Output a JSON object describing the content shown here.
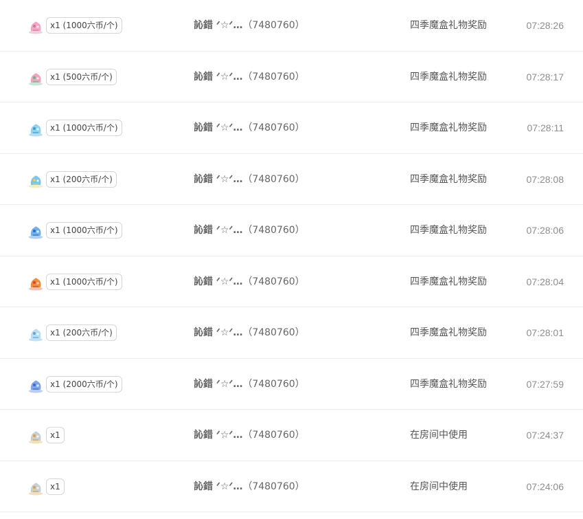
{
  "records": [
    {
      "icon": "pink-bunny-gift-icon",
      "icon_color": "#f4a7c4",
      "icon_accent": "#c77aa0",
      "qty": "x1 (1000六币/个)",
      "user_name": "訫錯 ᐟ☆ᐟ…",
      "user_id": "（7480760）",
      "reason": "四季魔盒礼物奖励",
      "time": "07:28:26"
    },
    {
      "icon": "lotus-gift-icon",
      "icon_color": "#f3a3c0",
      "icon_accent": "#66b98a",
      "qty": "x1 (500六币/个)",
      "user_name": "訫錯 ᐟ☆ᐟ…",
      "user_id": "（7480760）",
      "reason": "四季魔盒礼物奖励",
      "time": "07:28:17"
    },
    {
      "icon": "ice-swirl-gift-icon",
      "icon_color": "#8fd3ef",
      "icon_accent": "#3c9ccf",
      "qty": "x1 (1000六币/个)",
      "user_name": "訫錯 ᐟ☆ᐟ…",
      "user_id": "（7480760）",
      "reason": "四季魔盒礼物奖励",
      "time": "07:28:11"
    },
    {
      "icon": "flower-garland-gift-icon",
      "icon_color": "#7cc6e8",
      "icon_accent": "#f0c94a",
      "qty": "x1 (200六币/个)",
      "user_name": "訫錯 ᐟ☆ᐟ…",
      "user_id": "（7480760）",
      "reason": "四季魔盒礼物奖励",
      "time": "07:28:08"
    },
    {
      "icon": "ice-castle-gift-icon",
      "icon_color": "#6fb3ea",
      "icon_accent": "#2a6fc2",
      "qty": "x1 (1000六币/个)",
      "user_name": "訫錯 ᐟ☆ᐟ…",
      "user_id": "（7480760）",
      "reason": "四季魔盒礼物奖励",
      "time": "07:28:06"
    },
    {
      "icon": "fox-gift-icon",
      "icon_color": "#f28a3c",
      "icon_accent": "#d9452b",
      "qty": "x1 (1000六币/个)",
      "user_name": "訫錯 ᐟ☆ᐟ…",
      "user_id": "（7480760）",
      "reason": "四季魔盒礼物奖励",
      "time": "07:28:04"
    },
    {
      "icon": "snow-figure-gift-icon",
      "icon_color": "#b8def0",
      "icon_accent": "#5aa8d8",
      "qty": "x1 (200六币/个)",
      "user_name": "訫錯 ᐟ☆ᐟ…",
      "user_id": "（7480760）",
      "reason": "四季魔盒礼物奖励",
      "time": "07:28:01"
    },
    {
      "icon": "blue-fairy-gift-icon",
      "icon_color": "#7fa6e6",
      "icon_accent": "#3d6cc9",
      "qty": "x1 (2000六币/个)",
      "user_name": "訫錯 ᐟ☆ᐟ…",
      "user_id": "（7480760）",
      "reason": "四季魔盒礼物奖励",
      "time": "07:27:59"
    },
    {
      "icon": "crown-gift-icon",
      "icon_color": "#c9cfd6",
      "icon_accent": "#d9a441",
      "qty": "x1",
      "user_name": "訫錯 ᐟ☆ᐟ…",
      "user_id": "（7480760）",
      "reason": "在房间中使用",
      "time": "07:24:37"
    },
    {
      "icon": "crown-gift-icon",
      "icon_color": "#c9cfd6",
      "icon_accent": "#d9a441",
      "qty": "x1",
      "user_name": "訫錯 ᐟ☆ᐟ…",
      "user_id": "（7480760）",
      "reason": "在房间中使用",
      "time": "07:24:06"
    }
  ]
}
